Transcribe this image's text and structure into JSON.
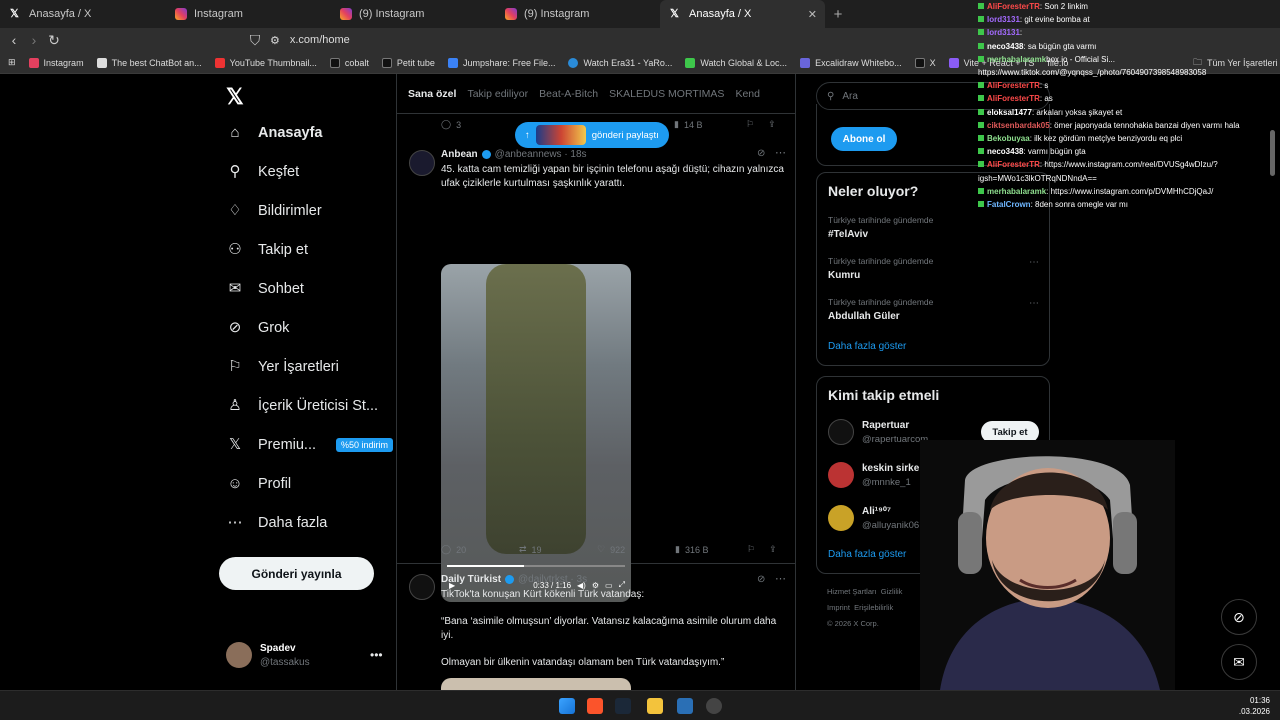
{
  "browser": {
    "tabs": [
      {
        "title": "Anasayfa / X",
        "icon": "x-icon"
      },
      {
        "title": "Instagram",
        "icon": "instagram-icon"
      },
      {
        "title": "(9) Instagram",
        "icon": "instagram-icon"
      },
      {
        "title": "(9) Instagram",
        "icon": "instagram-icon"
      },
      {
        "title": "Anasayfa / X",
        "icon": "x-icon",
        "active": true
      }
    ],
    "url": "x.com/home",
    "bookmarks": [
      "Instagram",
      "The best ChatBot an...",
      "YouTube Thumbnail...",
      "cobalt",
      "Petit tube",
      "Jumpshare: Free File...",
      "Watch Era31 - YaRo...",
      "Watch Global & Loc...",
      "Excalidraw Whitebo...",
      "X",
      "Vite + React + TS",
      "file.io"
    ],
    "bookmarks_folder": "Tüm Yer İşaretleri"
  },
  "sidebar": {
    "items": [
      {
        "label": "Anasayfa",
        "icon": "home-icon"
      },
      {
        "label": "Keşfet",
        "icon": "search-icon"
      },
      {
        "label": "Bildirimler",
        "icon": "bell-icon"
      },
      {
        "label": "Takip et",
        "icon": "add-user-icon"
      },
      {
        "label": "Sohbet",
        "icon": "mail-icon"
      },
      {
        "label": "Grok",
        "icon": "grok-icon"
      },
      {
        "label": "Yer İşaretleri",
        "icon": "bookmark-icon"
      },
      {
        "label": "İçerik Üreticisi St...",
        "icon": "creator-icon"
      },
      {
        "label": "Premiu...",
        "icon": "x-premium-icon",
        "badge": "%50 indirim"
      },
      {
        "label": "Profil",
        "icon": "profile-icon"
      },
      {
        "label": "Daha fazla",
        "icon": "more-icon"
      }
    ],
    "post_button": "Gönderi yayınla",
    "user": {
      "name": "Spadev",
      "handle": "@tassakus"
    }
  },
  "feed": {
    "tabs": [
      "Sana özel",
      "Takip ediliyor",
      "Beat-A-Bitch",
      "SKALEDUS MORTIMAS",
      "Kend"
    ],
    "share_pill": "gönderi paylaştı",
    "prev_actions": {
      "replies": "3",
      "views": "14 B"
    },
    "tweets": [
      {
        "name": "Anbean",
        "handle": "@anbeannews · 18s",
        "text": "45. katta cam temizliği yapan bir işçinin telefonu aşağı düştü; cihazın yalnızca ufak çiziklerle kurtulması şaşkınlık yarattı.",
        "video_time": "0:33 / 1:16",
        "video_progress": 0.43,
        "replies": "20",
        "retweets": "19",
        "likes": "922",
        "views": "316 B"
      },
      {
        "name": "Daily Türkist",
        "handle": "@dailytrkst · 3s",
        "line1": "TikTok'ta konuşan Kürt kökenli Türk vatandaş:",
        "line2": "“Bana ‘asimile olmuşsun’ diyorlar. Vatansız kalacağıma asimile olurum daha iyi.",
        "line3": "Olmayan bir ülkenin vatandaşı olamam ben Türk vatandaşıyım.”"
      }
    ]
  },
  "right": {
    "search_placeholder": "Ara",
    "subscribe_button": "Abone ol",
    "trends_title": "Neler oluyor?",
    "trends": [
      {
        "context": "Türkiye tarihinde gündemde",
        "name": "#TelAviv"
      },
      {
        "context": "Türkiye tarihinde gündemde",
        "name": "Kumru"
      },
      {
        "context": "Türkiye tarihinde gündemde",
        "name": "Abdullah Güler"
      }
    ],
    "show_more": "Daha fazla göster",
    "who_title": "Kimi takip etmeli",
    "who": [
      {
        "name": "Rapertuar",
        "handle": "@rapertuarcom",
        "button": "Takip et"
      },
      {
        "name": "keskin sirke",
        "handle": "@mnnke_1"
      },
      {
        "name": "Ali¹⁹⁰⁷",
        "handle": "@alluyanik06"
      }
    ],
    "footer": [
      "Hizmet Şartları",
      "Gizlilik",
      "Imprint",
      "Erişilebilirlik",
      "© 2026 X Corp."
    ]
  },
  "chat": [
    {
      "user": "AliForesterTR",
      "msg": ": Son 2 linkim"
    },
    {
      "user": "lord3131",
      "msg": ": git evine bomba at"
    },
    {
      "user": "lord3131",
      "msg": ":"
    },
    {
      "user": "neco3438",
      "msg": ": sa bügün gta varmı"
    },
    {
      "user": "merhabalaramk",
      "msg": "box.io - Official Si..."
    },
    {
      "user": "",
      "msg": "https://www.tiktok.com/@yqnqss_/photo/7604907398548983058"
    },
    {
      "user": "AliForesterTR",
      "msg": ": s"
    },
    {
      "user": "AliForesterTR",
      "msg": ": as"
    },
    {
      "user": "eloksal1477",
      "msg": ": arkaları yoksa şikayet et"
    },
    {
      "user": "ciktsenbardak05",
      "msg": ": ömer japonyada tennohakia banzai diyen varmı hala"
    },
    {
      "user": "Bekobuyaa",
      "msg": ": ilk kez gördüm metçlye benziyordu eq plci"
    },
    {
      "user": "neco3438",
      "msg": ": varmı bügün gta"
    },
    {
      "user": "AliForesterTR",
      "msg": ": https://www.instagram.com/reel/DVUSg4wDIzu/?"
    },
    {
      "user": "",
      "msg": "igsh=MWo1c3lkOTRqNDNndA=="
    },
    {
      "user": "merhabalaramk",
      "msg": ": https://www.instagram.com/p/DVMHhCDjQaJ/"
    },
    {
      "user": "FatalCrown",
      "msg": ": 8den sonra omegle var mı"
    }
  ],
  "taskbar": {
    "time": "01:36",
    "date": ".03.2026"
  },
  "colors": {
    "accent": "#1d9bf0",
    "bg": "#000000",
    "text": "#e7e9ea",
    "muted": "#71767b"
  }
}
